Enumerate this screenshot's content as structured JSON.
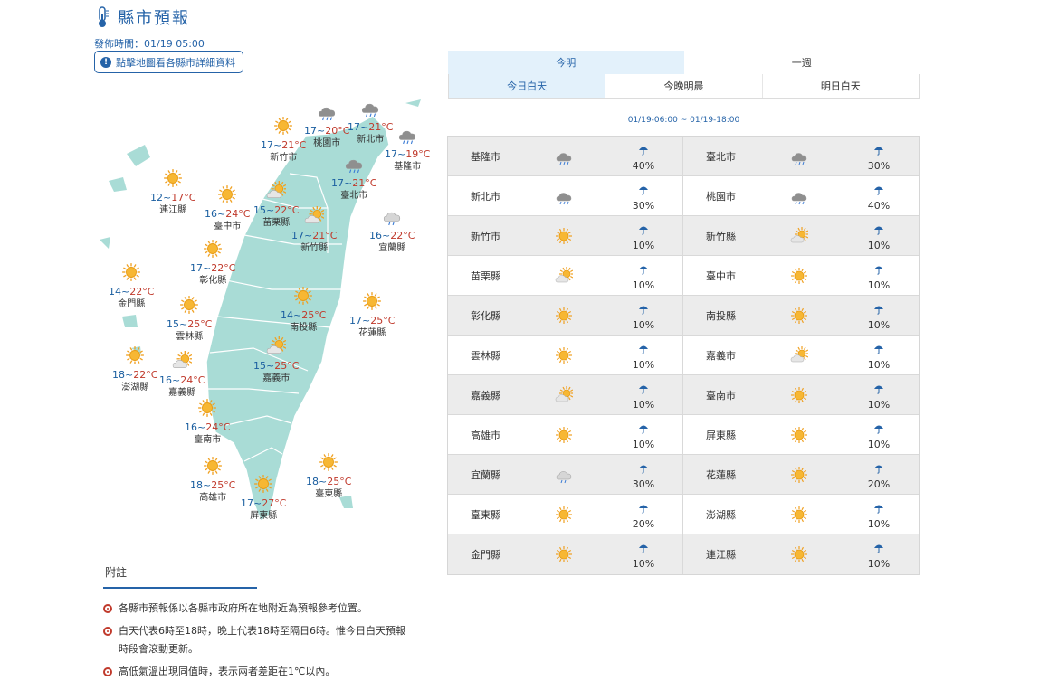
{
  "header": {
    "title": "縣市預報",
    "pubtime": "發佈時間：01/19 05:00",
    "hint": "點擊地圖看各縣市詳細資料"
  },
  "tabs": {
    "top": [
      "今明",
      "一週"
    ],
    "sub": [
      "今日白天",
      "今晚明晨",
      "明日白天"
    ]
  },
  "period": "01/19-06:00 ~ 01/19-18:00",
  "map_labels": [
    {
      "city": "桃園市",
      "lo": "17",
      "hi": "20°C",
      "icon": "cloudy-rain"
    },
    {
      "city": "新北市",
      "lo": "17",
      "hi": "21°C",
      "icon": "cloudy-rain"
    },
    {
      "city": "基隆市",
      "lo": "17",
      "hi": "19°C",
      "icon": "cloudy-rain"
    },
    {
      "city": "新竹市",
      "lo": "17",
      "hi": "21°C",
      "icon": "sunny"
    },
    {
      "city": "臺北市",
      "lo": "17",
      "hi": "21°C",
      "icon": "cloudy-rain"
    },
    {
      "city": "連江縣",
      "lo": "12",
      "hi": "17°C",
      "icon": "sunny"
    },
    {
      "city": "臺中市",
      "lo": "16",
      "hi": "24°C",
      "icon": "sunny"
    },
    {
      "city": "苗栗縣",
      "lo": "15",
      "hi": "22°C",
      "icon": "partly-cloudy"
    },
    {
      "city": "新竹縣",
      "lo": "17",
      "hi": "21°C",
      "icon": "partly-cloudy"
    },
    {
      "city": "宜蘭縣",
      "lo": "16",
      "hi": "22°C",
      "icon": "cloudy-rain-light"
    },
    {
      "city": "彰化縣",
      "lo": "17",
      "hi": "22°C",
      "icon": "sunny"
    },
    {
      "city": "金門縣",
      "lo": "14",
      "hi": "22°C",
      "icon": "sunny"
    },
    {
      "city": "南投縣",
      "lo": "14",
      "hi": "25°C",
      "icon": "sunny"
    },
    {
      "city": "花蓮縣",
      "lo": "17",
      "hi": "25°C",
      "icon": "sunny"
    },
    {
      "city": "雲林縣",
      "lo": "15",
      "hi": "25°C",
      "icon": "sunny"
    },
    {
      "city": "嘉義市",
      "lo": "15",
      "hi": "25°C",
      "icon": "partly-cloudy"
    },
    {
      "city": "澎湖縣",
      "lo": "18",
      "hi": "22°C",
      "icon": "sunny"
    },
    {
      "city": "嘉義縣",
      "lo": "16",
      "hi": "24°C",
      "icon": "partly-cloudy"
    },
    {
      "city": "臺南市",
      "lo": "16",
      "hi": "24°C",
      "icon": "sunny"
    },
    {
      "city": "高雄市",
      "lo": "18",
      "hi": "25°C",
      "icon": "sunny"
    },
    {
      "city": "屏東縣",
      "lo": "17",
      "hi": "27°C",
      "icon": "sunny"
    },
    {
      "city": "臺東縣",
      "lo": "18",
      "hi": "25°C",
      "icon": "sunny"
    }
  ],
  "table": [
    [
      {
        "name": "基隆市",
        "icon": "cloudy-rain",
        "pop": "40%"
      },
      {
        "name": "臺北市",
        "icon": "cloudy-rain",
        "pop": "30%"
      }
    ],
    [
      {
        "name": "新北市",
        "icon": "cloudy-rain",
        "pop": "30%"
      },
      {
        "name": "桃園市",
        "icon": "cloudy-rain",
        "pop": "40%"
      }
    ],
    [
      {
        "name": "新竹市",
        "icon": "sunny",
        "pop": "10%"
      },
      {
        "name": "新竹縣",
        "icon": "partly-cloudy",
        "pop": "10%"
      }
    ],
    [
      {
        "name": "苗栗縣",
        "icon": "partly-cloudy",
        "pop": "10%"
      },
      {
        "name": "臺中市",
        "icon": "sunny",
        "pop": "10%"
      }
    ],
    [
      {
        "name": "彰化縣",
        "icon": "sunny",
        "pop": "10%"
      },
      {
        "name": "南投縣",
        "icon": "sunny",
        "pop": "10%"
      }
    ],
    [
      {
        "name": "雲林縣",
        "icon": "sunny",
        "pop": "10%"
      },
      {
        "name": "嘉義市",
        "icon": "partly-cloudy",
        "pop": "10%"
      }
    ],
    [
      {
        "name": "嘉義縣",
        "icon": "partly-cloudy",
        "pop": "10%"
      },
      {
        "name": "臺南市",
        "icon": "sunny",
        "pop": "10%"
      }
    ],
    [
      {
        "name": "高雄市",
        "icon": "sunny",
        "pop": "10%"
      },
      {
        "name": "屏東縣",
        "icon": "sunny",
        "pop": "10%"
      }
    ],
    [
      {
        "name": "宜蘭縣",
        "icon": "cloudy-rain-light",
        "pop": "30%"
      },
      {
        "name": "花蓮縣",
        "icon": "sunny",
        "pop": "20%"
      }
    ],
    [
      {
        "name": "臺東縣",
        "icon": "sunny",
        "pop": "20%"
      },
      {
        "name": "澎湖縣",
        "icon": "sunny",
        "pop": "10%"
      }
    ],
    [
      {
        "name": "金門縣",
        "icon": "sunny",
        "pop": "10%"
      },
      {
        "name": "連江縣",
        "icon": "sunny",
        "pop": "10%"
      }
    ]
  ],
  "notes": {
    "title": "附註",
    "items": [
      "各縣市預報係以各縣市政府所在地附近為預報參考位置。",
      "白天代表6時至18時，晚上代表18時至隔日6時。惟今日白天預報時段會滾動更新。",
      "高低氣溫出現同值時，表示兩者差距在1℃以內。"
    ]
  },
  "colors": {
    "accent": "#2563a8",
    "hi_temp": "#c0392b",
    "land": "#a9dcd6",
    "tab_active": "#e3f1fb"
  }
}
